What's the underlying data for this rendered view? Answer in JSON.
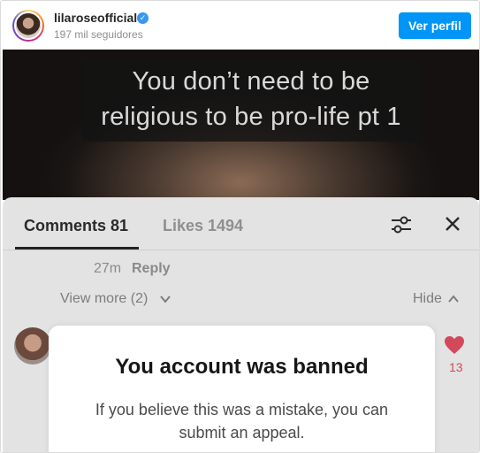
{
  "header": {
    "username": "lilaroseofficial",
    "verified_icon": "verified-badge-icon",
    "followers": "197 mil seguidores",
    "profile_button": "Ver perfil"
  },
  "video": {
    "caption": "You don’t need to be religious to be pro-life pt 1"
  },
  "comments_panel": {
    "tabs": [
      {
        "label": "Comments 81",
        "active": true
      },
      {
        "label": "Likes 1494",
        "active": false
      }
    ],
    "icons": [
      "filter-sliders-icon",
      "close-icon"
    ],
    "reply_meta": {
      "time": "27m",
      "reply_label": "Reply"
    },
    "view_more": "View more (2)",
    "hide": "Hide",
    "comment": {
      "like_count": "13"
    }
  },
  "modal": {
    "title": "You account was banned",
    "body": "If you believe this was a mistake, you can submit an appeal."
  },
  "colors": {
    "primary_button": "#0095f6",
    "heart": "#d2495c",
    "panel_dim": "#e3e3e3"
  }
}
